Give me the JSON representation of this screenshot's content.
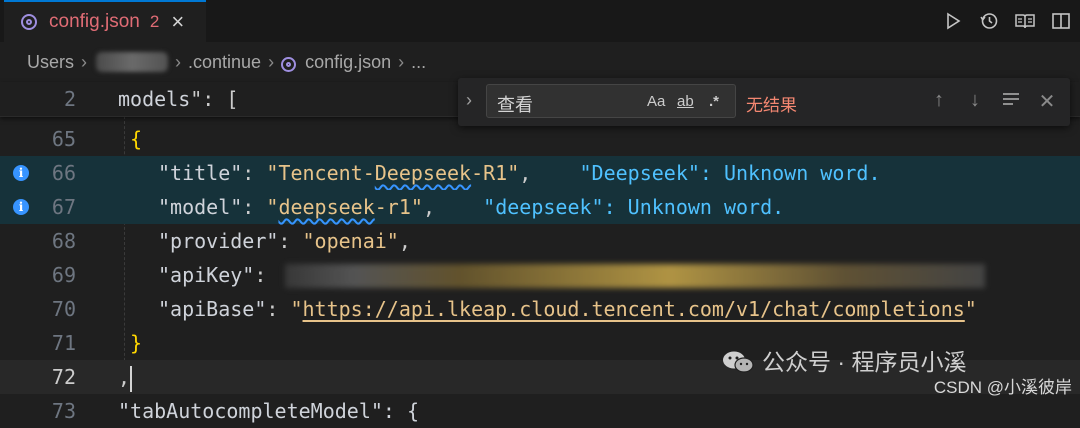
{
  "tab": {
    "filename": "config.json",
    "problems": "2",
    "close": "×"
  },
  "toolbar": {
    "icons": [
      "run-icon",
      "history-icon",
      "preview-icon",
      "split-editor-icon"
    ]
  },
  "breadcrumb": {
    "items": [
      "Users",
      ".continue",
      "config.json",
      "..."
    ]
  },
  "find": {
    "query": "查看",
    "match_case": "Aa",
    "whole_word": "ab",
    "regex": ".*",
    "result": "无结果"
  },
  "editor": {
    "sticky": {
      "number": "2",
      "key": "models",
      "rest": "\": ["
    },
    "lines": [
      {
        "number": "65",
        "text": "{"
      },
      {
        "number": "66",
        "key": "\"title\"",
        "colon": ": ",
        "value_pre": "\"Tencent-",
        "value_squig": "Deepseek",
        "value_post": "-R1\"",
        "trail": ",",
        "diagnostic": "\"Deepseek\": Unknown word."
      },
      {
        "number": "67",
        "key": "\"model\"",
        "colon": ": ",
        "value_pre": "\"",
        "value_squig": "deepseek",
        "value_post": "-r1\"",
        "trail": ",",
        "diagnostic": "\"deepseek\": Unknown word."
      },
      {
        "number": "68",
        "key": "\"provider\"",
        "colon": ": ",
        "value": "\"openai\"",
        "trail": ","
      },
      {
        "number": "69",
        "key": "\"apiKey\"",
        "colon": ":"
      },
      {
        "number": "70",
        "key": "\"apiBase\"",
        "colon": ": ",
        "quote_open": "\"",
        "url": "https://api.lkeap.cloud.tencent.com/v1/chat/completions",
        "quote_close": "\""
      },
      {
        "number": "71",
        "text": "}"
      },
      {
        "number": "72",
        "text": ","
      },
      {
        "number": "73",
        "text": "\"tabAutocompleteModel\": {"
      }
    ]
  },
  "watermark": {
    "text": "公众号 · 程序员小溪",
    "csdn": "CSDN @小溪彼岸"
  },
  "colors": {
    "accent": "#0078d4",
    "error": "#e06c75",
    "string": "#e7c38a",
    "info": "#3794ff",
    "find_result": "#f48771"
  }
}
